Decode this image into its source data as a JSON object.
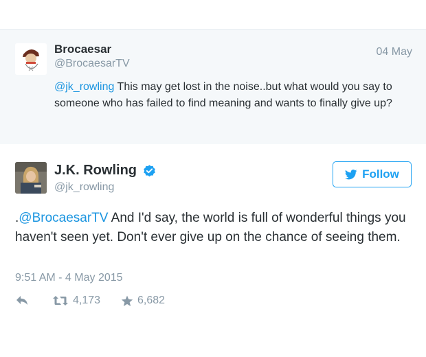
{
  "reply": {
    "name": "Brocaesar",
    "handle": "@BrocaesarTV",
    "date": "04 May",
    "mention": "@jk_rowling",
    "text": " This may get lost in the noise..but what would you say to someone who has failed to find meaning and wants to finally give up?"
  },
  "tweet": {
    "name": "J.K. Rowling",
    "handle": "@jk_rowling",
    "follow_label": "Follow",
    "text_prefix": ".",
    "mention": "@BrocaesarTV",
    "text": " And I'd say, the world is full of wonderful things you haven't seen yet. Don't ever give up on the chance of seeing them.",
    "timestamp": "9:51 AM - 4 May 2015",
    "retweets": "4,173",
    "favorites": "6,682"
  },
  "colors": {
    "link": "#1b95e0",
    "follow": "#1da1f2",
    "muted": "#8899a6",
    "background_reply": "#f5f8fa"
  }
}
